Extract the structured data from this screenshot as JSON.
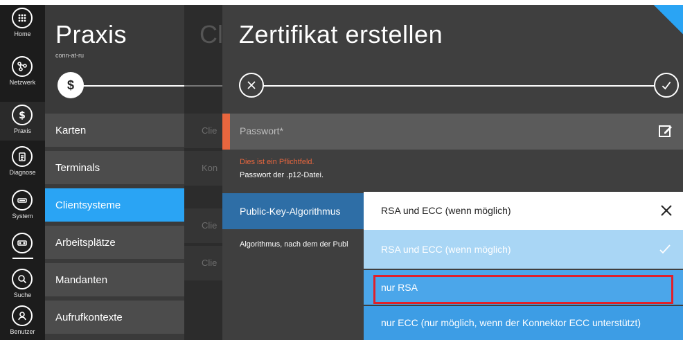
{
  "rail": {
    "items": [
      {
        "label": "Home",
        "icon": "grid-icon"
      },
      {
        "label": "Netzwerk",
        "icon": "network-icon"
      },
      {
        "label": "Praxis",
        "icon": "staff-icon"
      },
      {
        "label": "Diagnose",
        "icon": "clipboard-icon"
      },
      {
        "label": "System",
        "icon": "system-icon"
      },
      {
        "label": "",
        "icon": "connector-icon"
      },
      {
        "label": "Suche",
        "icon": "search-icon"
      },
      {
        "label": "Benutzer",
        "icon": "user-icon"
      }
    ]
  },
  "praxis": {
    "title": "Praxis",
    "subtitle": "conn-at-ru",
    "step_symbol": "$",
    "nav": [
      "Karten",
      "Terminals",
      "Clientsysteme",
      "Arbeitsplätze",
      "Mandanten",
      "Aufrufkontexte"
    ],
    "active_nav": "Clientsysteme"
  },
  "middle": {
    "title": "Cl",
    "rows": [
      "Clie",
      "Kon",
      "Clie",
      "Clie"
    ]
  },
  "main": {
    "title": "Zertifikat erstellen",
    "password_placeholder": "Passwort*",
    "error": "Dies ist ein Pflichtfeld.",
    "hint": "Passwort der .p12-Datei.",
    "algo_label": "Public-Key-Algorithmus",
    "algo_desc": "Algorithmus, nach dem der Publ"
  },
  "dropdown": {
    "selected": "RSA und ECC (wenn möglich)",
    "options": [
      "RSA und ECC (wenn möglich)",
      "nur RSA",
      "nur ECC (nur möglich, wenn der Konnektor ECC unterstützt)"
    ]
  },
  "colors": {
    "accent": "#2aa4f4",
    "error": "#e8663e",
    "highlight": "#e0202a"
  }
}
